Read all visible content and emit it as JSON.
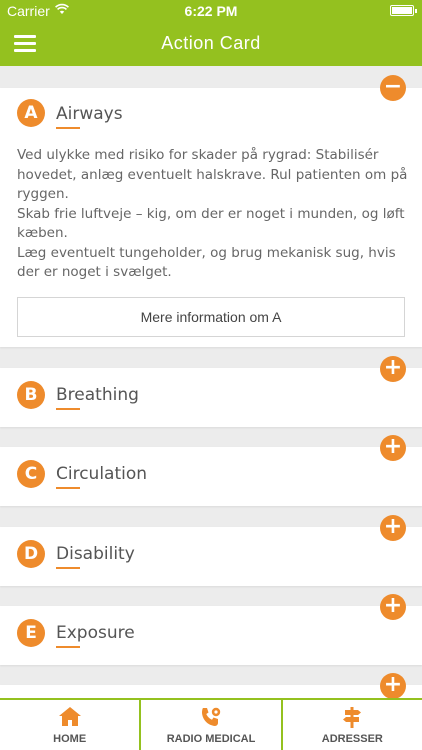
{
  "status_bar": {
    "carrier": "Carrier",
    "time": "6:22 PM"
  },
  "nav": {
    "title": "Action Card",
    "menu_icon": "hamburger-menu-icon"
  },
  "colors": {
    "brand_green": "#94c11f",
    "accent_orange": "#ee8b2c"
  },
  "cards": [
    {
      "letter": "A",
      "title": "Airways",
      "expanded": true,
      "toggle": "−",
      "paragraphs": [
        "Ved ulykke med risiko for skader på rygrad: Stabilisér hovedet, anlæg eventuelt halskrave. Rul patienten om på ryggen.",
        "Skab frie luftveje – kig, om der er noget i munden, og løft kæben.",
        "Læg eventuelt tungeholder, og brug mekanisk sug, hvis der er noget i svælget."
      ],
      "more_label": "Mere information om A"
    },
    {
      "letter": "B",
      "title": "Breathing",
      "expanded": false,
      "toggle": "+"
    },
    {
      "letter": "C",
      "title": "Circulation",
      "expanded": false,
      "toggle": "+"
    },
    {
      "letter": "D",
      "title": "Disability",
      "expanded": false,
      "toggle": "+"
    },
    {
      "letter": "E",
      "title": "Exposure",
      "expanded": false,
      "toggle": "+"
    }
  ],
  "partial_card_toggle": "+",
  "tabs": [
    {
      "label": "HOME",
      "icon": "home-icon"
    },
    {
      "label": "RADIO MEDICAL",
      "icon": "phone-gear-icon"
    },
    {
      "label": "ADRESSER",
      "icon": "signpost-icon"
    }
  ]
}
